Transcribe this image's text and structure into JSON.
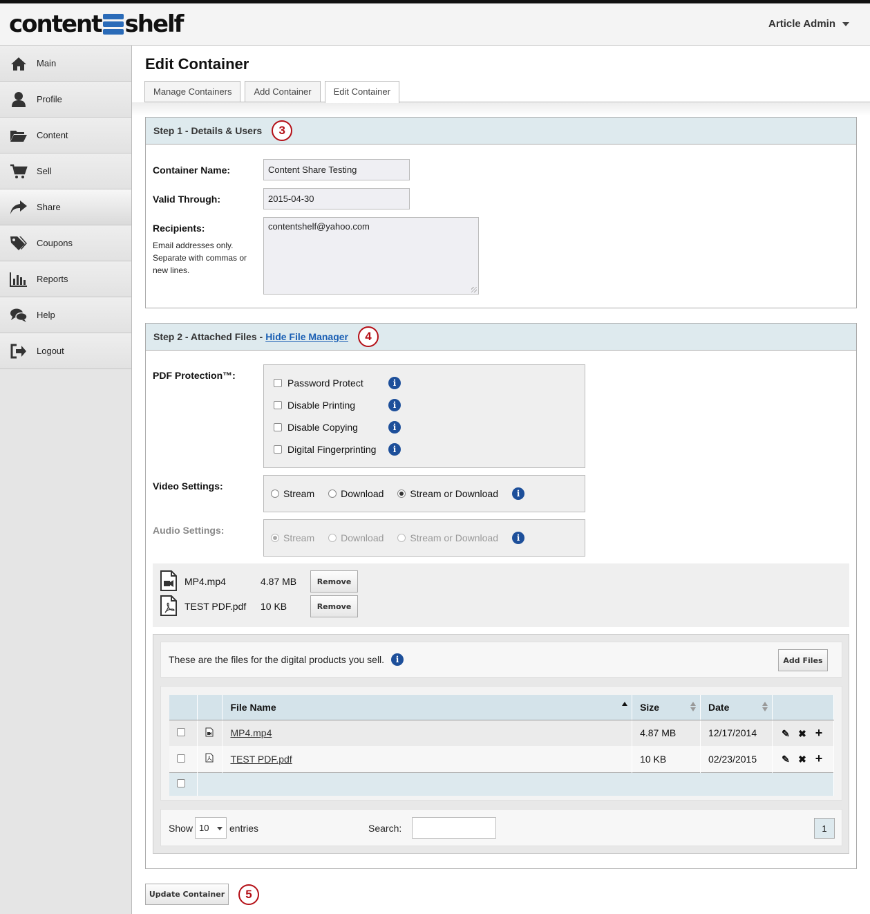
{
  "brand": {
    "logo_left": "content",
    "logo_right": "shelf",
    "accent": "#2a6bb8"
  },
  "user_menu": {
    "label": "Article Admin"
  },
  "sidebar": {
    "items": [
      {
        "label": "Main",
        "icon": "home-icon"
      },
      {
        "label": "Profile",
        "icon": "user-icon"
      },
      {
        "label": "Content",
        "icon": "folder-icon"
      },
      {
        "label": "Sell",
        "icon": "cart-icon"
      },
      {
        "label": "Share",
        "icon": "share-icon"
      },
      {
        "label": "Coupons",
        "icon": "tags-icon"
      },
      {
        "label": "Reports",
        "icon": "bar-chart-icon"
      },
      {
        "label": "Help",
        "icon": "chat-icon"
      },
      {
        "label": "Logout",
        "icon": "logout-icon"
      }
    ],
    "active": "Share"
  },
  "page": {
    "title": "Edit Container"
  },
  "tabs": [
    {
      "label": "Manage Containers"
    },
    {
      "label": "Add Container"
    },
    {
      "label": "Edit Container"
    }
  ],
  "step1": {
    "title": "Step 1 - Details & Users",
    "callout": "3",
    "container_name_label": "Container Name:",
    "container_name_value": "Content Share Testing",
    "valid_through_label": "Valid Through:",
    "valid_through_value": "2015-04-30",
    "recipients_label": "Recipients:",
    "recipients_help_1": "Email addresses only.",
    "recipients_help_2": "Separate with commas or",
    "recipients_help_3": "new lines.",
    "recipients_value": "contentshelf@yahoo.com"
  },
  "step2": {
    "title": "Step 2 - Attached Files - ",
    "link": "Hide File Manager",
    "callout": "4",
    "pdf_label": "PDF Protection™:",
    "pdf_options": [
      {
        "label": "Password Protect",
        "checked": false
      },
      {
        "label": "Disable Printing",
        "checked": false
      },
      {
        "label": "Disable Copying",
        "checked": false
      },
      {
        "label": "Digital Fingerprinting",
        "checked": false
      }
    ],
    "video_label": "Video Settings:",
    "audio_label": "Audio Settings:",
    "radio_options": {
      "stream": "Stream",
      "download": "Download",
      "both": "Stream or Download"
    },
    "video_selected": "Stream or Download",
    "audio_selected": "Stream",
    "attached_files": [
      {
        "name": "MP4.mp4",
        "size": "4.87 MB",
        "button": "Remove",
        "icon": "video-file-icon"
      },
      {
        "name": "TEST PDF.pdf",
        "size": "10 KB",
        "button": "Remove",
        "icon": "pdf-file-icon"
      }
    ]
  },
  "file_manager": {
    "intro": "These are the files for the digital products you sell.",
    "add_button": "Add Files",
    "columns": {
      "name": "File Name",
      "size": "Size",
      "date": "Date"
    },
    "rows": [
      {
        "name": "MP4.mp4",
        "size": "4.87 MB",
        "date": "12/17/2014",
        "icon": "video-file-icon"
      },
      {
        "name": "TEST PDF.pdf",
        "size": "10 KB",
        "date": "02/23/2015",
        "icon": "pdf-file-icon"
      }
    ],
    "show_label": "Show",
    "entries_value": "10",
    "entries_label": "entries",
    "search_label": "Search:",
    "search_value": "",
    "page": "1"
  },
  "footer": {
    "update_button": "Update Container",
    "callout": "5"
  }
}
